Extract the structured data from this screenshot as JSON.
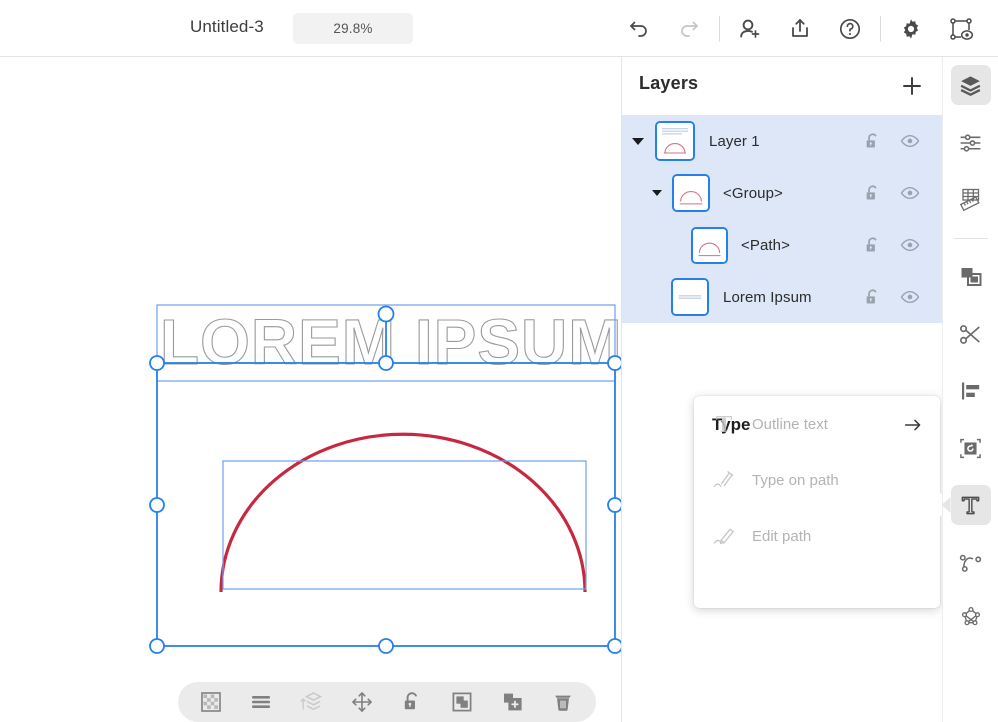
{
  "topbar": {
    "document_title": "Untitled-3",
    "zoom_level": "29.8%",
    "buttons": [
      {
        "name": "undo-button",
        "icon": "undo-icon",
        "enabled": true
      },
      {
        "name": "redo-button",
        "icon": "redo-icon",
        "enabled": false
      },
      {
        "name": "invite-button",
        "icon": "add-user-icon",
        "enabled": true
      },
      {
        "name": "share-button",
        "icon": "share-export-icon",
        "enabled": true
      },
      {
        "name": "help-button",
        "icon": "help-circle-icon",
        "enabled": true
      },
      {
        "name": "settings-button",
        "icon": "gear-icon",
        "enabled": true
      },
      {
        "name": "preview-button",
        "icon": "preview-path-icon",
        "enabled": true
      }
    ]
  },
  "canvas": {
    "text_object": "LOREM IPSUM",
    "shape_stroke_color": "#c8283f",
    "selection_color": "#2680eb",
    "text_outline_color": "#9a9a9a"
  },
  "context_toolbar": {
    "items": [
      {
        "name": "opacity-button",
        "icon": "checkerboard-icon",
        "enabled": true
      },
      {
        "name": "align-button",
        "icon": "align-lines-icon",
        "enabled": true
      },
      {
        "name": "arrange-order-button",
        "icon": "layer-order-icon",
        "enabled": false
      },
      {
        "name": "move-button",
        "icon": "move-arrows-icon",
        "enabled": true
      },
      {
        "name": "lock-button",
        "icon": "unlock-icon",
        "enabled": true
      },
      {
        "name": "group-button",
        "icon": "group-icon",
        "enabled": true
      },
      {
        "name": "duplicate-button",
        "icon": "duplicate-plus-icon",
        "enabled": true
      },
      {
        "name": "delete-button",
        "icon": "trash-icon",
        "enabled": true
      }
    ]
  },
  "layers_panel": {
    "title": "Layers",
    "add_icon": "plus-icon",
    "rows": [
      {
        "label": "Layer 1",
        "indent": 0,
        "twisty": true,
        "thumb": "arch-with-text",
        "lock_icon": "unlock-icon",
        "visibility_icon": "eye-icon"
      },
      {
        "label": "<Group>",
        "indent": 1,
        "twisty": true,
        "thumb": "arch",
        "lock_icon": "unlock-icon",
        "visibility_icon": "eye-icon"
      },
      {
        "label": "<Path>",
        "indent": 2,
        "twisty": false,
        "thumb": "arch",
        "lock_icon": "unlock-icon",
        "visibility_icon": "eye-icon"
      },
      {
        "label": "Lorem Ipsum",
        "indent": 1,
        "twisty": false,
        "thumb": "text-line",
        "lock_icon": "unlock-icon",
        "visibility_icon": "eye-icon"
      }
    ]
  },
  "type_flyout": {
    "title": "Type",
    "expand_icon": "arrow-right-icon",
    "items": [
      {
        "label": "Outline text",
        "icon": "outline-text-icon",
        "enabled": false
      },
      {
        "label": "Type on path",
        "icon": "type-on-path-icon",
        "enabled": false
      },
      {
        "label": "Edit path",
        "icon": "edit-path-icon",
        "enabled": false
      }
    ]
  },
  "right_rail": {
    "tools": [
      {
        "name": "rail-layers",
        "icon": "layers-stack-icon",
        "active": true
      },
      {
        "name": "rail-properties",
        "icon": "sliders-icon",
        "active": false
      },
      {
        "name": "rail-ruler",
        "icon": "ruler-grid-icon",
        "active": false
      },
      {
        "name": "rail-arrange",
        "icon": "arrange-icon",
        "active": false
      },
      {
        "name": "rail-cut",
        "icon": "scissors-icon",
        "active": false
      },
      {
        "name": "rail-align",
        "icon": "align-left-icon",
        "active": false
      },
      {
        "name": "rail-transform",
        "icon": "transform-icon",
        "active": false
      },
      {
        "name": "rail-type",
        "icon": "type-t-icon",
        "active": true
      },
      {
        "name": "rail-pen",
        "icon": "pen-path-icon",
        "active": false
      },
      {
        "name": "rail-shapes",
        "icon": "shapes-node-icon",
        "active": false
      }
    ]
  }
}
